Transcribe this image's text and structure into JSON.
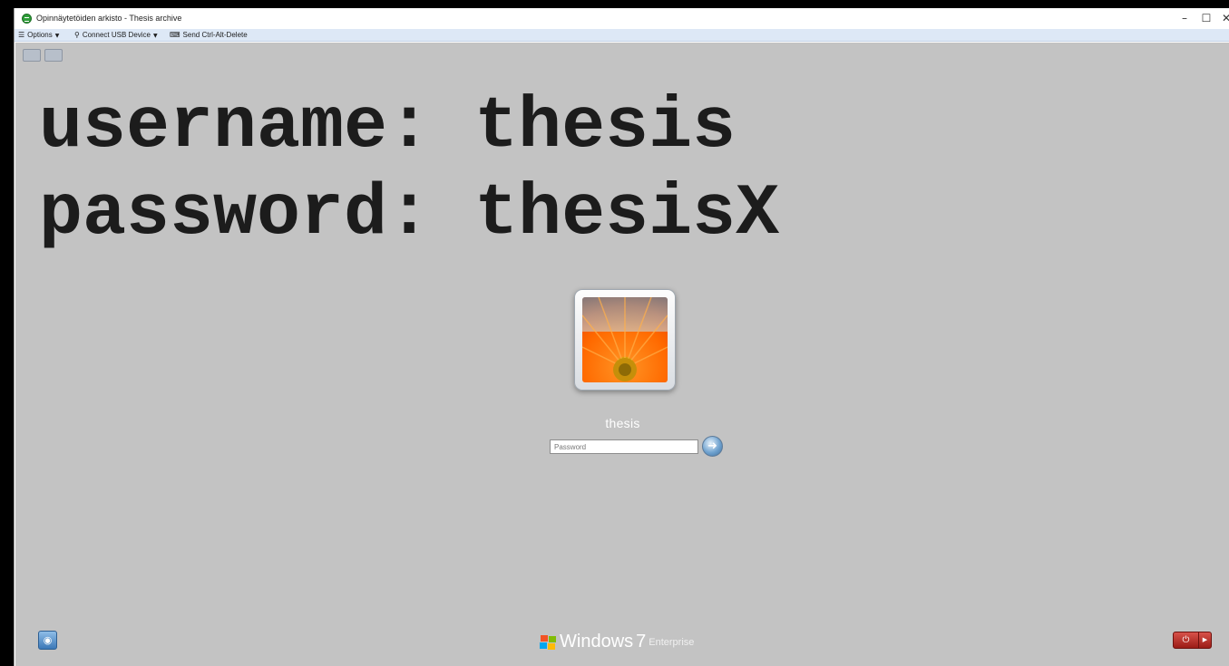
{
  "window": {
    "title": "Opinnäytetöiden arkisto - Thesis archive",
    "minimize_glyph": "–",
    "maximize_glyph": "☐",
    "close_glyph": "✕"
  },
  "toolbar": {
    "options_label": "Options",
    "usb_label": "Connect USB Device",
    "cad_label": "Send Ctrl-Alt-Delete"
  },
  "session_bar": {
    "pin_label": "",
    "minimize_label": ""
  },
  "overlay": {
    "line1": "username: thesis",
    "line2": "password: thesisX"
  },
  "login": {
    "username": "thesis",
    "password_placeholder": "Password",
    "password_value": "",
    "submit_glyph": "➜"
  },
  "footer": {
    "ease_of_access_glyph": "◉",
    "brand_name": "Windows",
    "brand_version": "7",
    "brand_edition": "Enterprise",
    "power_glyph": "⏻",
    "power_options_glyph": "▶"
  },
  "colors": {
    "screen_bg": "#c3c3c3",
    "toolbar_bg": "#dde8f6",
    "power_red": "#b42a22",
    "ease_blue": "#3b78b7"
  }
}
